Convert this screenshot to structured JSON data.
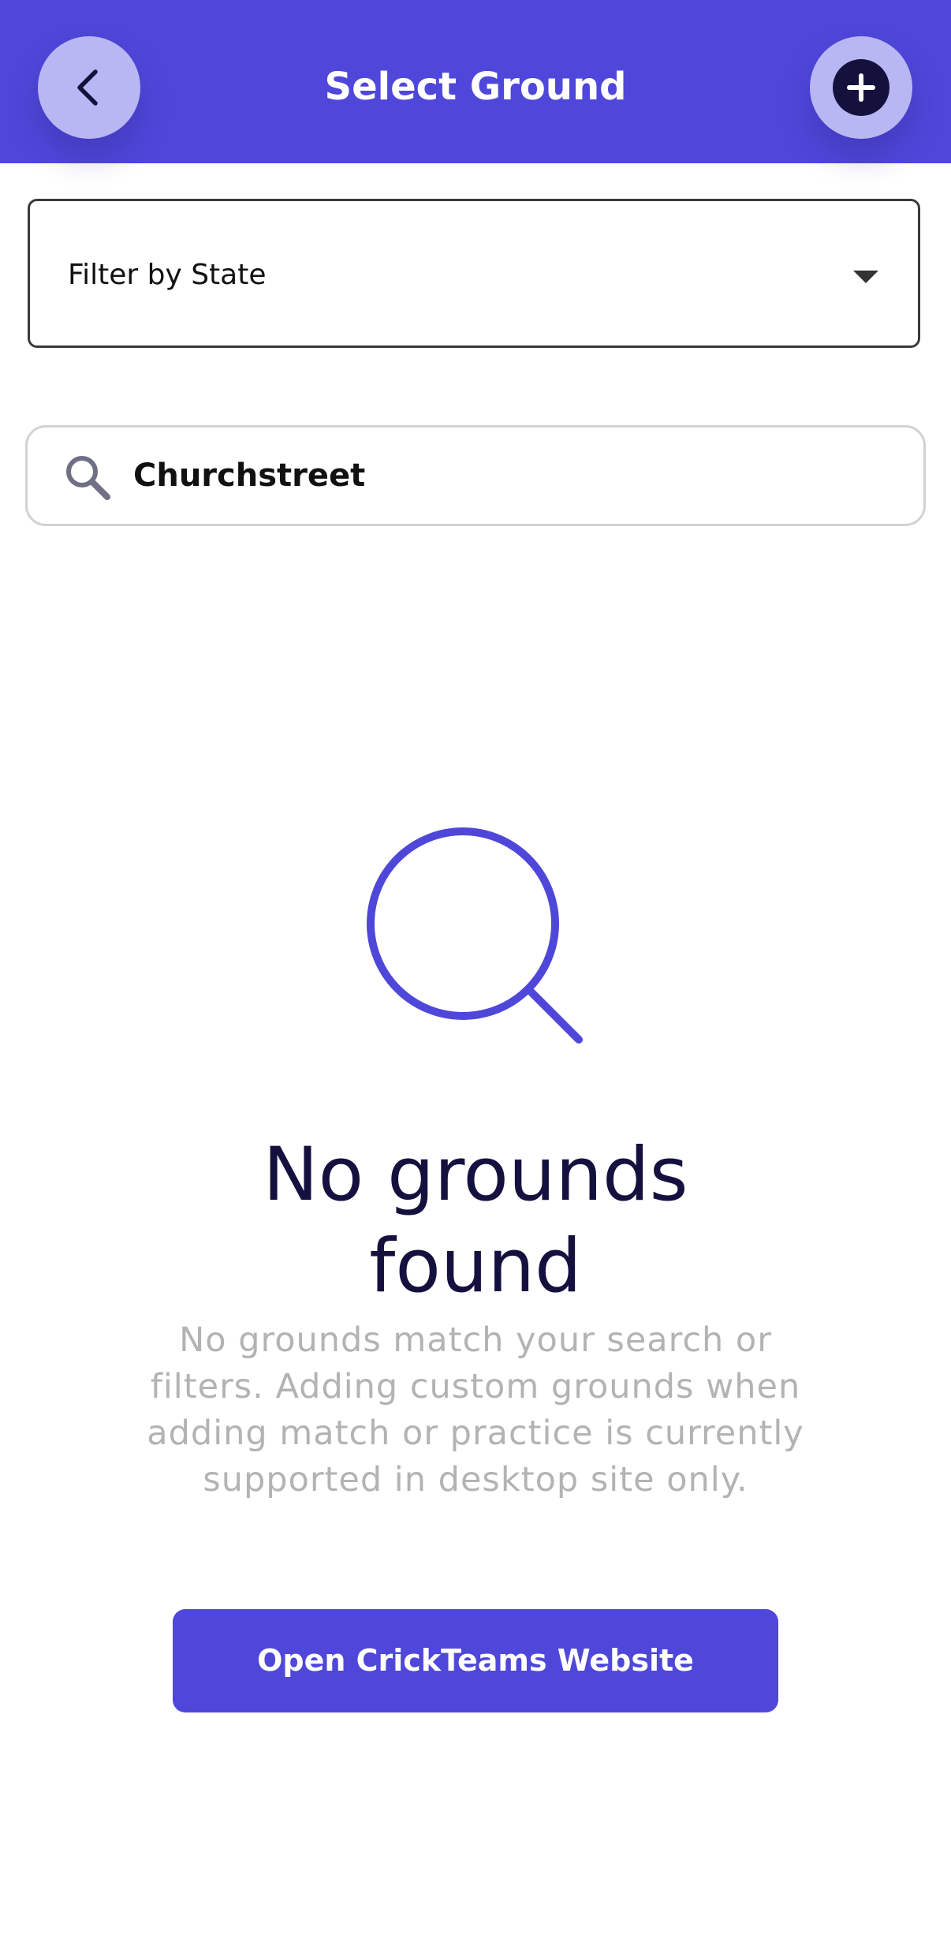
{
  "header": {
    "title": "Select Ground",
    "back_icon": "chevron-left-icon",
    "add_icon": "plus-circle-icon",
    "background_color": "#4f47da"
  },
  "filter": {
    "label": "Filter by State",
    "icon": "caret-down-icon"
  },
  "search": {
    "value": "Churchstreet",
    "icon": "search-icon"
  },
  "empty_state": {
    "icon": "magnifier-icon",
    "title": "No grounds found",
    "description": "No grounds match your search or filters. Adding custom grounds when adding match or practice is currently supported in desktop site only.",
    "button_label": "Open CrickTeams Website",
    "accent_color": "#4f47da"
  }
}
